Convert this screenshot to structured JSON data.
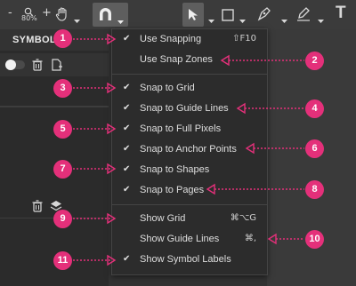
{
  "toolbar": {
    "zoom_out": "-",
    "zoom_level": "80%",
    "zoom_in": "+",
    "text_tool": "T"
  },
  "left_panel": {
    "tab": "SYMBOLS"
  },
  "menu": {
    "items": [
      {
        "label": "Use Snapping",
        "checked": true,
        "shortcut": "⇧F10"
      },
      {
        "label": "Use Snap Zones",
        "checked": false,
        "shortcut": ""
      },
      {
        "label": "Snap to Grid",
        "checked": true,
        "shortcut": ""
      },
      {
        "label": "Snap to Guide Lines",
        "checked": true,
        "shortcut": ""
      },
      {
        "label": "Snap to Full Pixels",
        "checked": true,
        "shortcut": ""
      },
      {
        "label": "Snap to Anchor Points",
        "checked": true,
        "shortcut": ""
      },
      {
        "label": "Snap to Shapes",
        "checked": true,
        "shortcut": ""
      },
      {
        "label": "Snap to Pages",
        "checked": true,
        "shortcut": ""
      },
      {
        "label": "Show Grid",
        "checked": false,
        "shortcut": "⌘⌥G"
      },
      {
        "label": "Show Guide Lines",
        "checked": false,
        "shortcut": "⌘,"
      },
      {
        "label": "Show Symbol Labels",
        "checked": true,
        "shortcut": ""
      }
    ]
  },
  "callouts": [
    "1",
    "2",
    "3",
    "4",
    "5",
    "6",
    "7",
    "8",
    "9",
    "10",
    "11"
  ],
  "colors": {
    "callout": "#e4307a",
    "menu_bg": "#2c2c2c"
  }
}
